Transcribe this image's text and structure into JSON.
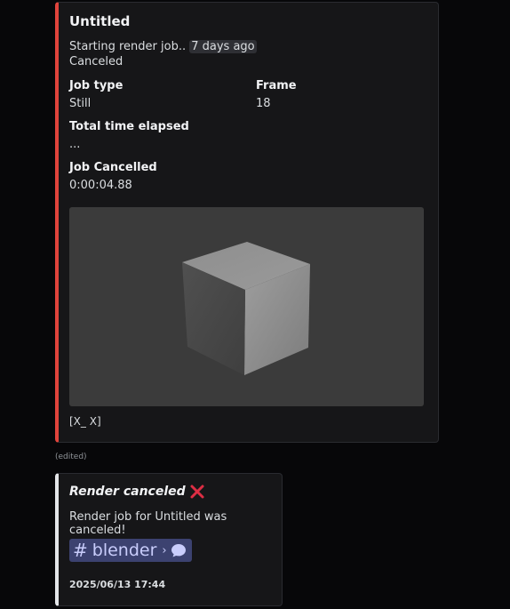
{
  "embed1": {
    "title": "Untitled",
    "desc_prefix": "Starting render job.. ",
    "desc_timestamp": "7 days ago",
    "status": "Canceled",
    "fields": {
      "job_type_name": "Job type",
      "job_type_value": "Still",
      "frame_name": "Frame",
      "frame_value": "18",
      "elapsed_name": "Total time elapsed",
      "elapsed_value": "...",
      "cancelled_name": "Job Cancelled",
      "cancelled_value": "0:00:04.88"
    },
    "image_icon": "rendered-cube-image",
    "footer": "[X_ X]",
    "accent_color": "#e0443c"
  },
  "edited_label": "(edited)",
  "embed2": {
    "title": "Render canceled",
    "title_icon": "cross-mark-icon",
    "description": "Render job for Untitled was canceled!",
    "channel": {
      "name": "blender",
      "icon_hash": "hash-icon",
      "icon_thread": "speech-bubble-icon"
    },
    "footer": "2025/06/13 17:44",
    "accent_color": "#e3e5e8"
  }
}
